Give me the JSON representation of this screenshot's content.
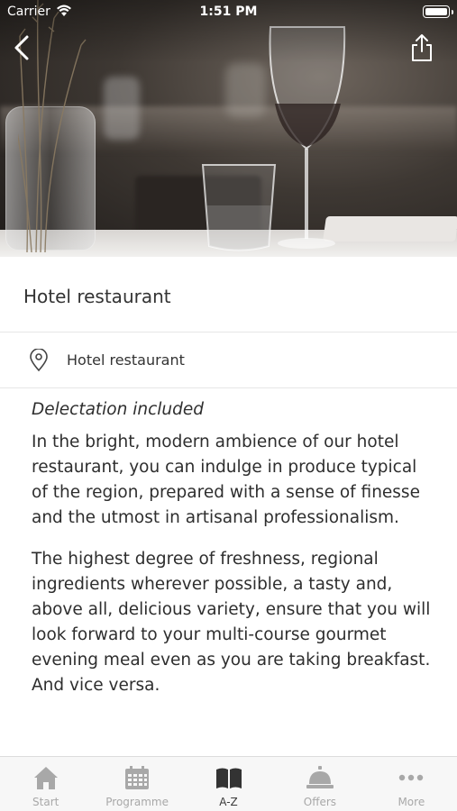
{
  "status_bar": {
    "carrier": "Carrier",
    "time": "1:51 PM"
  },
  "hero": {
    "description_icon": "restaurant-photo"
  },
  "nav": {
    "back_icon": "chevron-left-icon",
    "share_icon": "share-icon"
  },
  "page": {
    "title": "Hotel restaurant"
  },
  "location": {
    "icon": "location-pin-icon",
    "label": "Hotel restaurant"
  },
  "content": {
    "lead": "Delectation included",
    "paragraphs": [
      "In the bright, modern ambience of our hotel restaurant, you can indulge in produce typical of the region, prepared with a sense of finesse and the utmost in artisanal professionalism.",
      "The highest degree of freshness, regional ingredients wherever possible, a tasty and, above all, delicious variety, ensure that you will look forward to your multi-course gourmet evening meal even as you are taking breakfast. And vice versa."
    ]
  },
  "tabbar": {
    "items": [
      {
        "label": "Start",
        "icon": "home-icon",
        "active": false
      },
      {
        "label": "Programme",
        "icon": "calendar-icon",
        "active": false
      },
      {
        "label": "A-Z",
        "icon": "book-icon",
        "active": true
      },
      {
        "label": "Offers",
        "icon": "service-bell-icon",
        "active": false
      },
      {
        "label": "More",
        "icon": "more-dots-icon",
        "active": false
      }
    ]
  },
  "colors": {
    "active_tab": "#3a3a3a",
    "inactive_tab": "#a8a8a8",
    "divider": "#e6e6e6"
  }
}
